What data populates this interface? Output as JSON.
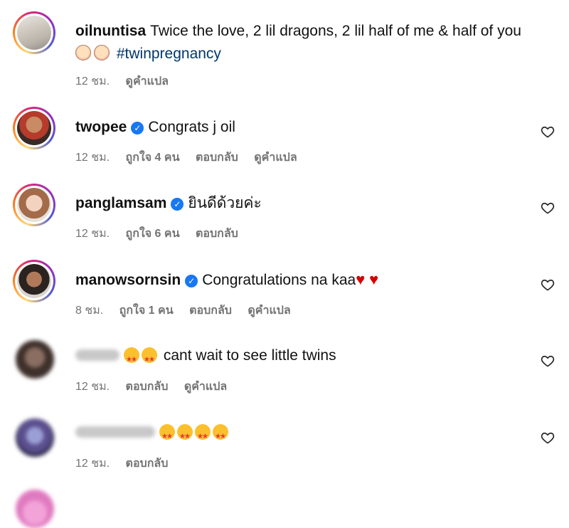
{
  "comments": [
    {
      "username": "oilnuntisa",
      "text": "Twice the love, 2 lil dragons, 2 lil half of me & half of you",
      "hashtag": "#twinpregnancy",
      "time": "12 ชม.",
      "translate": "ดูคำแปล"
    },
    {
      "username": "twopee",
      "text": "Congrats j oil",
      "time": "12 ชม.",
      "likes": "ถูกใจ 4 คน",
      "reply": "ตอบกลับ",
      "translate": "ดูคำแปล"
    },
    {
      "username": "panglamsam",
      "text": "ยินดีด้วยค่ะ",
      "time": "12 ชม.",
      "likes": "ถูกใจ 6 คน",
      "reply": "ตอบกลับ"
    },
    {
      "username": "manowsornsin",
      "text": "Congratulations na kaa",
      "time": "8 ชม.",
      "likes": "ถูกใจ 1 คน",
      "reply": "ตอบกลับ",
      "translate": "ดูคำแปล"
    },
    {
      "text": "cant wait to see little twins",
      "time": "12 ชม.",
      "reply": "ตอบกลับ",
      "translate": "ดูคำแปล"
    },
    {
      "time": "12 ชม.",
      "reply": "ตอบกลับ"
    }
  ],
  "icons": {
    "like": "heart-outline-icon",
    "verified": "verified-badge-icon"
  },
  "colors": {
    "meta_text": "#737373",
    "hashtag": "#00376b",
    "verified": "#1877f2"
  }
}
